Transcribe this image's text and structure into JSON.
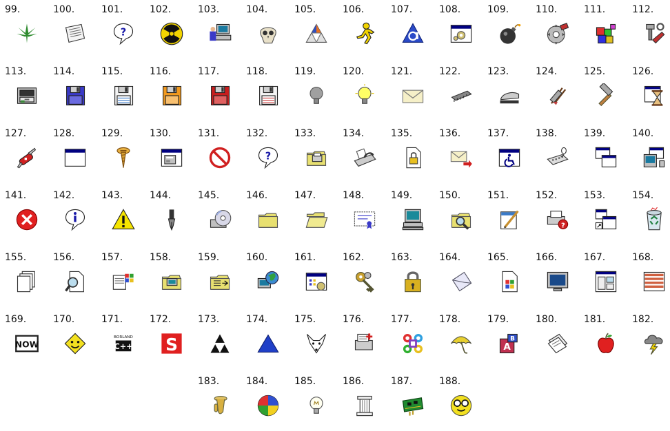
{
  "icon_grid": {
    "items": [
      {
        "num": "99.",
        "icon": "cannabis-leaf-icon"
      },
      {
        "num": "100.",
        "icon": "newspaper-icon"
      },
      {
        "num": "101.",
        "icon": "help-balloon-icon"
      },
      {
        "num": "102.",
        "icon": "radiation-icon"
      },
      {
        "num": "103.",
        "icon": "computer-user-icon"
      },
      {
        "num": "104.",
        "icon": "skull-icon"
      },
      {
        "num": "105.",
        "icon": "triangle-logo-icon"
      },
      {
        "num": "106.",
        "icon": "aim-runner-icon"
      },
      {
        "num": "107.",
        "icon": "aol-triangle-icon"
      },
      {
        "num": "108.",
        "icon": "window-gears-icon"
      },
      {
        "num": "109.",
        "icon": "bomb-icon"
      },
      {
        "num": "110.",
        "icon": "saw-blade-icon"
      },
      {
        "num": "111.",
        "icon": "colored-blocks-icon"
      },
      {
        "num": "112.",
        "icon": "tools-icon"
      },
      {
        "num": "113.",
        "icon": "file-cabinet-icon"
      },
      {
        "num": "114.",
        "icon": "floppy-blue-icon"
      },
      {
        "num": "115.",
        "icon": "floppy-white-blue-icon"
      },
      {
        "num": "116.",
        "icon": "floppy-orange-icon"
      },
      {
        "num": "117.",
        "icon": "floppy-red-icon"
      },
      {
        "num": "118.",
        "icon": "floppy-white-red-icon"
      },
      {
        "num": "119.",
        "icon": "lightbulb-off-icon"
      },
      {
        "num": "120.",
        "icon": "lightbulb-on-icon"
      },
      {
        "num": "121.",
        "icon": "envelope-icon"
      },
      {
        "num": "122.",
        "icon": "chip-icon"
      },
      {
        "num": "123.",
        "icon": "stapler-icon"
      },
      {
        "num": "124.",
        "icon": "shredder-icon"
      },
      {
        "num": "125.",
        "icon": "hammer-icon"
      },
      {
        "num": "126.",
        "icon": "hourglass-window-icon"
      },
      {
        "num": "127.",
        "icon": "swiss-knife-icon"
      },
      {
        "num": "128.",
        "icon": "blank-window-icon"
      },
      {
        "num": "129.",
        "icon": "screw-icon"
      },
      {
        "num": "130.",
        "icon": "window-dialog-icon"
      },
      {
        "num": "131.",
        "icon": "no-sign-icon"
      },
      {
        "num": "132.",
        "icon": "help-balloon-icon"
      },
      {
        "num": "133.",
        "icon": "folder-printer-icon"
      },
      {
        "num": "134.",
        "icon": "fax-icon"
      },
      {
        "num": "135.",
        "icon": "locked-document-icon"
      },
      {
        "num": "136.",
        "icon": "mail-send-icon"
      },
      {
        "num": "137.",
        "icon": "accessibility-icon"
      },
      {
        "num": "138.",
        "icon": "keyboard-mouse-icon"
      },
      {
        "num": "139.",
        "icon": "cascade-windows-icon"
      },
      {
        "num": "140.",
        "icon": "windows-network-icon"
      },
      {
        "num": "141.",
        "icon": "error-icon"
      },
      {
        "num": "142.",
        "icon": "info-icon"
      },
      {
        "num": "143.",
        "icon": "warning-icon"
      },
      {
        "num": "144.",
        "icon": "fountain-pen-icon"
      },
      {
        "num": "145.",
        "icon": "cd-drive-icon"
      },
      {
        "num": "146.",
        "icon": "folder-closed-icon"
      },
      {
        "num": "147.",
        "icon": "folder-open-icon"
      },
      {
        "num": "148.",
        "icon": "certificate-icon"
      },
      {
        "num": "149.",
        "icon": "computer-icon"
      },
      {
        "num": "150.",
        "icon": "folder-search-icon"
      },
      {
        "num": "151.",
        "icon": "edit-document-icon"
      },
      {
        "num": "152.",
        "icon": "printer-help-icon"
      },
      {
        "num": "153.",
        "icon": "shortcut-windows-icon"
      },
      {
        "num": "154.",
        "icon": "recycle-bin-icon"
      },
      {
        "num": "155.",
        "icon": "documents-stack-icon"
      },
      {
        "num": "156.",
        "icon": "document-search-icon"
      },
      {
        "num": "157.",
        "icon": "windows-flag-icon"
      },
      {
        "num": "158.",
        "icon": "folder-computer-icon"
      },
      {
        "num": "159.",
        "icon": "folder-list-icon"
      },
      {
        "num": "160.",
        "icon": "network-globe-icon"
      },
      {
        "num": "161.",
        "icon": "window-settings-icon"
      },
      {
        "num": "162.",
        "icon": "keys-icon"
      },
      {
        "num": "163.",
        "icon": "padlock-icon"
      },
      {
        "num": "164.",
        "icon": "envelope-open-icon"
      },
      {
        "num": "165.",
        "icon": "windows-document-icon"
      },
      {
        "num": "166.",
        "icon": "monitor-icon"
      },
      {
        "num": "167.",
        "icon": "multiple-windows-icon"
      },
      {
        "num": "168.",
        "icon": "brick-wall-icon"
      },
      {
        "num": "169.",
        "icon": "now-logo-icon"
      },
      {
        "num": "170.",
        "icon": "smiley-face-icon"
      },
      {
        "num": "171.",
        "icon": "borland-cpp-icon"
      },
      {
        "num": "172.",
        "icon": "red-s-logo-icon"
      },
      {
        "num": "173.",
        "icon": "triforce-icon"
      },
      {
        "num": "174.",
        "icon": "blue-triangle-icon"
      },
      {
        "num": "175.",
        "icon": "fox-face-icon"
      },
      {
        "num": "176.",
        "icon": "printer-add-icon"
      },
      {
        "num": "177.",
        "icon": "command-key-icon"
      },
      {
        "num": "178.",
        "icon": "umbrella-icon"
      },
      {
        "num": "179.",
        "icon": "abc-blocks-icon"
      },
      {
        "num": "180.",
        "icon": "papers-icon"
      },
      {
        "num": "181.",
        "icon": "apple-icon"
      },
      {
        "num": "182.",
        "icon": "storm-cloud-icon"
      },
      {
        "num": "183.",
        "icon": "tuba-icon"
      },
      {
        "num": "184.",
        "icon": "beach-ball-icon"
      },
      {
        "num": "185.",
        "icon": "lightbulb-icon"
      },
      {
        "num": "186.",
        "icon": "pillar-icon"
      },
      {
        "num": "187.",
        "icon": "circuit-board-icon"
      },
      {
        "num": "188.",
        "icon": "nerd-smiley-icon"
      }
    ]
  },
  "colors": {
    "folder": "#e8e070",
    "window_title": "#000080",
    "error": "#e02020",
    "warning": "#f5e400",
    "floppy_blue": "#3a3ac8",
    "floppy_orange": "#f29a1f",
    "floppy_red": "#c81e1e"
  }
}
